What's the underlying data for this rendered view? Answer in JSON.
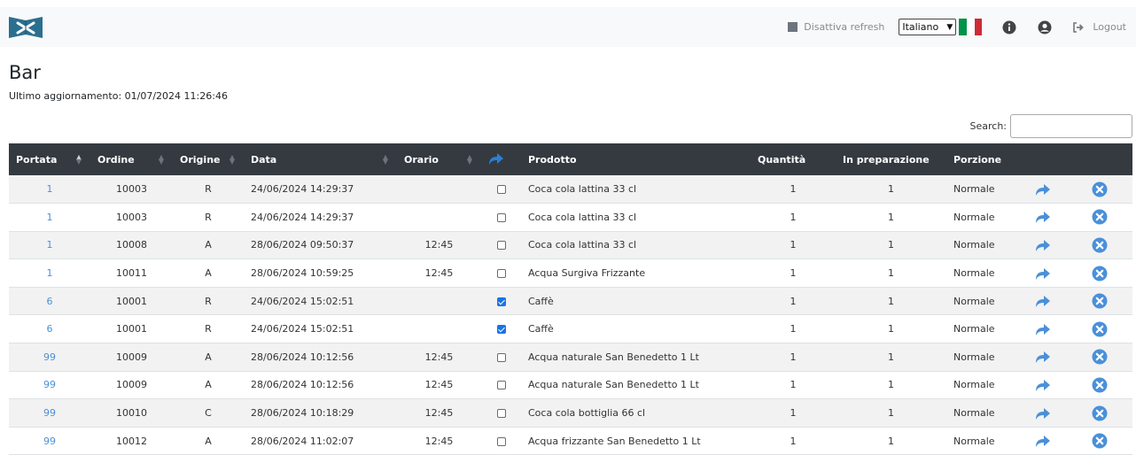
{
  "header": {
    "refresh_label": "Disattiva refresh",
    "language": "Italiano",
    "logout_label": "Logout"
  },
  "page": {
    "title": "Bar",
    "last_update": "Ultimo aggiornamento: 01/07/2024 11:26:46",
    "search_label": "Search:",
    "search_value": ""
  },
  "colors": {
    "navbar_bg": "#f8f9fa",
    "table_header_bg": "#343a40",
    "accent_blue": "#4a90d9",
    "logo_teal": "#2b6f8e"
  },
  "table": {
    "columns": [
      "Portata",
      "Ordine",
      "Origine",
      "Data",
      "Orario",
      "",
      "Prodotto",
      "Quantità",
      "In preparazione",
      "Porzione",
      "",
      ""
    ],
    "rows": [
      {
        "portata": "1",
        "ordine": "10003",
        "origine": "R",
        "data": "24/06/2024 14:29:37",
        "orario": "",
        "checked": false,
        "prodotto": "Coca cola lattina 33 cl",
        "quantita": "1",
        "preparazione": "1",
        "porzione": "Normale"
      },
      {
        "portata": "1",
        "ordine": "10003",
        "origine": "R",
        "data": "24/06/2024 14:29:37",
        "orario": "",
        "checked": false,
        "prodotto": "Coca cola lattina 33 cl",
        "quantita": "1",
        "preparazione": "1",
        "porzione": "Normale"
      },
      {
        "portata": "1",
        "ordine": "10008",
        "origine": "A",
        "data": "28/06/2024 09:50:37",
        "orario": "12:45",
        "checked": false,
        "prodotto": "Coca cola lattina 33 cl",
        "quantita": "1",
        "preparazione": "1",
        "porzione": "Normale"
      },
      {
        "portata": "1",
        "ordine": "10011",
        "origine": "A",
        "data": "28/06/2024 10:59:25",
        "orario": "12:45",
        "checked": false,
        "prodotto": "Acqua Surgiva Frizzante",
        "quantita": "1",
        "preparazione": "1",
        "porzione": "Normale"
      },
      {
        "portata": "6",
        "ordine": "10001",
        "origine": "R",
        "data": "24/06/2024 15:02:51",
        "orario": "",
        "checked": true,
        "prodotto": "Caffè",
        "quantita": "1",
        "preparazione": "1",
        "porzione": "Normale"
      },
      {
        "portata": "6",
        "ordine": "10001",
        "origine": "R",
        "data": "24/06/2024 15:02:51",
        "orario": "",
        "checked": true,
        "prodotto": "Caffè",
        "quantita": "1",
        "preparazione": "1",
        "porzione": "Normale"
      },
      {
        "portata": "99",
        "ordine": "10009",
        "origine": "A",
        "data": "28/06/2024 10:12:56",
        "orario": "12:45",
        "checked": false,
        "prodotto": "Acqua naturale San Benedetto 1 Lt",
        "quantita": "1",
        "preparazione": "1",
        "porzione": "Normale"
      },
      {
        "portata": "99",
        "ordine": "10009",
        "origine": "A",
        "data": "28/06/2024 10:12:56",
        "orario": "12:45",
        "checked": false,
        "prodotto": "Acqua naturale San Benedetto 1 Lt",
        "quantita": "1",
        "preparazione": "1",
        "porzione": "Normale"
      },
      {
        "portata": "99",
        "ordine": "10010",
        "origine": "C",
        "data": "28/06/2024 10:18:29",
        "orario": "12:45",
        "checked": false,
        "prodotto": "Coca cola bottiglia 66 cl",
        "quantita": "1",
        "preparazione": "1",
        "porzione": "Normale"
      },
      {
        "portata": "99",
        "ordine": "10012",
        "origine": "A",
        "data": "28/06/2024 11:02:07",
        "orario": "12:45",
        "checked": false,
        "prodotto": "Acqua frizzante San Benedetto 1 Lt",
        "quantita": "1",
        "preparazione": "1",
        "porzione": "Normale"
      }
    ]
  }
}
